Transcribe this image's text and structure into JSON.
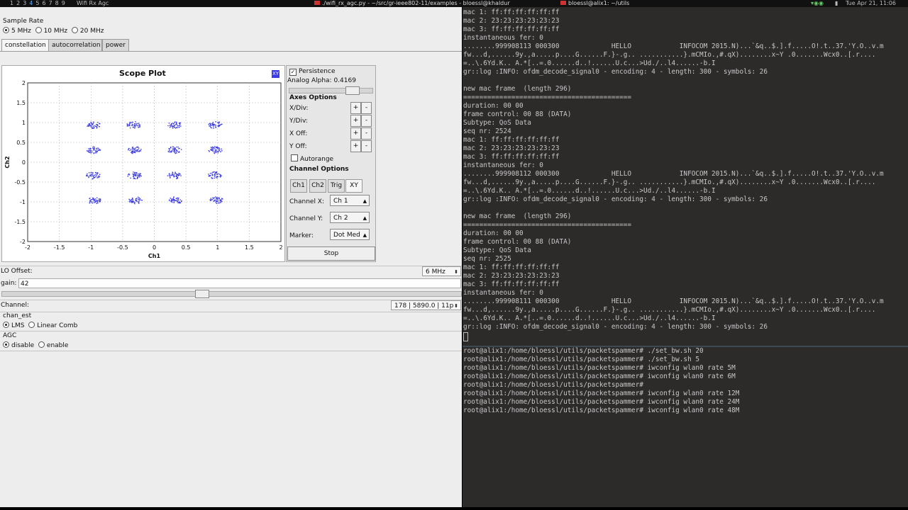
{
  "topbar": {
    "workspaces": [
      "1",
      "2",
      "3",
      "4",
      "5",
      "6",
      "7",
      "8",
      "9"
    ],
    "current_workspace": "4",
    "app_label": "Wifi Rx Agc",
    "window1_title": "./wifi_rx_agc.py - ~/src/gr-ieee802-11/examples - bloessl@khaldur",
    "window2_title": "bloessl@alix1: ~/utils",
    "clock": "Tue Apr 21, 11:06"
  },
  "left": {
    "sample_rate_label": "Sample Rate",
    "sample_rate_options": [
      "5 MHz",
      "10 MHz",
      "20 MHz"
    ],
    "sample_rate_selected": "5 MHz",
    "tabs": [
      "constellation",
      "autocorrelation",
      "power"
    ],
    "active_tab": "constellation",
    "lo_offset_label": "LO Offset:",
    "lo_offset_value": "6 MHz",
    "gain_label": "gain:",
    "gain_value": "42",
    "gain_slider_fraction": 0.42,
    "channel_label": "Channel:",
    "channel_value": "178 | 5890.0 | 11p",
    "chan_est_label": "chan_est",
    "chan_est_options": [
      "LMS",
      "Linear Comb"
    ],
    "chan_est_selected": "LMS",
    "agc_label": "AGC",
    "agc_options": [
      "disable",
      "enable"
    ],
    "agc_selected": "disable"
  },
  "scope": {
    "title": "Scope Plot",
    "xy_badge": "XY",
    "controls": {
      "persistence_label": "Persistence",
      "persistence_checked": true,
      "analog_alpha_label": "Analog Alpha: 0.4169",
      "analog_alpha_fraction": 0.4169,
      "axes_options_label": "Axes Options",
      "axes_rows": [
        "X/Div:",
        "Y/Div:",
        "X Off:",
        "Y Off:"
      ],
      "plus": "+",
      "minus": "-",
      "autorange_label": "Autorange",
      "channel_options_label": "Channel Options",
      "channel_tabs": [
        "Ch1",
        "Ch2",
        "Trig",
        "XY"
      ],
      "active_channel_tab": "XY",
      "channel_x_label": "Channel X:",
      "channel_x_value": "Ch 1",
      "channel_y_label": "Channel Y:",
      "channel_y_value": "Ch 2",
      "marker_label": "Marker:",
      "marker_value": "Dot Med",
      "stop_label": "Stop"
    }
  },
  "chart_data": {
    "type": "scatter",
    "title": "Scope Plot",
    "xlabel": "Ch1",
    "ylabel": "Ch2",
    "xlim": [
      -2,
      2
    ],
    "ylim": [
      -2,
      2
    ],
    "xticks": [
      "-2",
      "-1.5",
      "-1",
      "-0.5",
      "0",
      "0.5",
      "1",
      "1.5",
      "2"
    ],
    "yticks": [
      "2",
      "1.5",
      "1",
      "0.5",
      "0",
      "-0.5",
      "-1",
      "-1.5",
      "-2"
    ],
    "grid": true,
    "point_color": "#3a3ae0",
    "clusters": [
      {
        "x": -0.97,
        "y": 0.95
      },
      {
        "x": -0.33,
        "y": 0.95
      },
      {
        "x": 0.32,
        "y": 0.95
      },
      {
        "x": 0.96,
        "y": 0.95
      },
      {
        "x": -0.97,
        "y": 0.32
      },
      {
        "x": -0.32,
        "y": 0.32
      },
      {
        "x": 0.31,
        "y": 0.32
      },
      {
        "x": 0.96,
        "y": 0.32
      },
      {
        "x": -0.97,
        "y": -0.32
      },
      {
        "x": -0.32,
        "y": -0.32
      },
      {
        "x": 0.31,
        "y": -0.32
      },
      {
        "x": 0.95,
        "y": -0.32
      },
      {
        "x": -0.96,
        "y": -0.95
      },
      {
        "x": -0.31,
        "y": -0.95
      },
      {
        "x": 0.33,
        "y": -0.95
      },
      {
        "x": 0.97,
        "y": -0.95
      }
    ]
  },
  "terminal": {
    "log_lines": [
      "mac 1: ff:ff:ff:ff:ff:ff",
      "mac 2: 23:23:23:23:23:23",
      "mac 3: ff:ff:ff:ff:ff:ff",
      "instantaneous fer: 0",
      "........999908113 000300             HELLO            INFOCOM 2015.N)...`&q..$.].f.....O!.t..37.'Y.O..v.m",
      "fw...d,......9y.,a.....p....G......F.}-.g.. ...........}.mCMIo.,#.qX)........x~Y .0.......Wcx0..[.r....",
      "=..\\.6Yd.K.. A.*[..=.0......d..!......U.c...>Ud./..l4......-b.I",
      "gr::log :INFO: ofdm_decode_signal0 - encoding: 4 - length: 300 - symbols: 26",
      "",
      "new mac frame  (length 296)",
      "==========================================",
      "duration: 00 00",
      "frame control: 00 88 (DATA)",
      "Subtype: QoS Data",
      "seq nr: 2524",
      "mac 1: ff:ff:ff:ff:ff:ff",
      "mac 2: 23:23:23:23:23:23",
      "mac 3: ff:ff:ff:ff:ff:ff",
      "instantaneous fer: 0",
      "........999908112 000300             HELLO            INFOCOM 2015.N)...`&q..$.].f.....O!.t..37.'Y.O..v.m",
      "fw...d,......9y.,a.....p....G......F.}-.g.. ...........}.mCMIo.,#.qX)........x~Y .0.......Wcx0..[.r....",
      "=..\\.6Yd.K.. A.*[..=.0......d..!......U.c...>Ud./..l4......-b.I",
      "gr::log :INFO: ofdm_decode_signal0 - encoding: 4 - length: 300 - symbols: 26",
      "",
      "new mac frame  (length 296)",
      "==========================================",
      "duration: 00 00",
      "frame control: 00 88 (DATA)",
      "Subtype: QoS Data",
      "seq nr: 2525",
      "mac 1: ff:ff:ff:ff:ff:ff",
      "mac 2: 23:23:23:23:23:23",
      "mac 3: ff:ff:ff:ff:ff:ff",
      "instantaneous fer: 0",
      "........999908111 000300             HELLO            INFOCOM 2015.N)...`&q..$.].f.....O!.t..37.'Y.O..v.m",
      "fw...d,......9y.,a.....p....G......F.}-.g.. ...........}.mCMIo.,#.qX)........x~Y .0.......Wcx0..[.r....",
      "=..\\.6Yd.K.. A.*[..=.0......d..!......U.c...>Ud./..l4......-b.I",
      "gr::log :INFO: ofdm_decode_signal0 - encoding: 4 - length: 300 - symbols: 26"
    ],
    "shell_lines": [
      "root@alix1:/home/bloessl/utils/packetspammer# ./set_bw.sh 20",
      "root@alix1:/home/bloessl/utils/packetspammer# ./set_bw.sh 5",
      "root@alix1:/home/bloessl/utils/packetspammer# iwconfig wlan0 rate 5M",
      "root@alix1:/home/bloessl/utils/packetspammer# iwconfig wlan0 rate 6M",
      "root@alix1:/home/bloessl/utils/packetspammer#",
      "root@alix1:/home/bloessl/utils/packetspammer# iwconfig wlan0 rate 12M",
      "root@alix1:/home/bloessl/utils/packetspammer# iwconfig wlan0 rate 24M",
      "root@alix1:/home/bloessl/utils/packetspammer# iwconfig wlan0 rate 48M"
    ]
  }
}
